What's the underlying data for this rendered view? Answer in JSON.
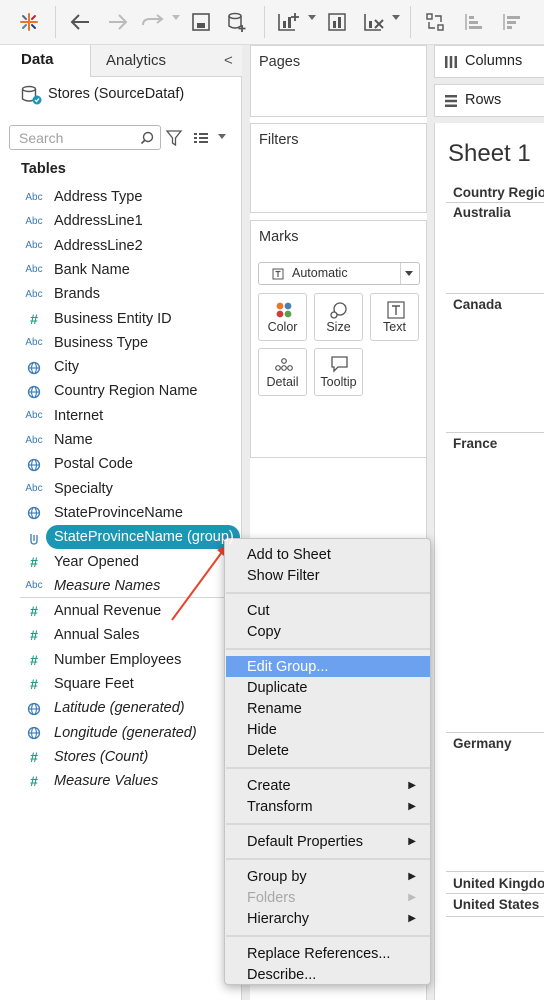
{
  "toolbar": {
    "icons": [
      "tableau-logo-icon",
      "back-icon",
      "forward-icon",
      "redo-icon",
      "save-icon",
      "new-datasource-icon",
      "new-worksheet-icon",
      "duplicate-sheet-icon",
      "clear-sheet-icon",
      "swap-icon",
      "sort-ascending-icon",
      "sort-descending-icon"
    ]
  },
  "data_pane": {
    "tabs": [
      "Data",
      "Analytics"
    ],
    "collapse_glyph": "<",
    "datasource": "Stores (SourceDataf)",
    "search_placeholder": "Search",
    "tables_heading": "Tables",
    "dimensions": [
      {
        "type": "Abc",
        "label": "Address Type"
      },
      {
        "type": "Abc",
        "label": "AddressLine1"
      },
      {
        "type": "Abc",
        "label": "AddressLine2"
      },
      {
        "type": "Abc",
        "label": "Bank Name"
      },
      {
        "type": "Abc",
        "label": "Brands"
      },
      {
        "type": "#",
        "label": "Business Entity ID"
      },
      {
        "type": "Abc",
        "label": "Business Type"
      },
      {
        "type": "globe",
        "label": "City"
      },
      {
        "type": "globe",
        "label": "Country Region Name"
      },
      {
        "type": "Abc",
        "label": "Internet"
      },
      {
        "type": "Abc",
        "label": "Name"
      },
      {
        "type": "globe",
        "label": "Postal Code"
      },
      {
        "type": "Abc",
        "label": "Specialty"
      },
      {
        "type": "globe",
        "label": "StateProvinceName"
      },
      {
        "type": "group",
        "label": "StateProvinceName (group)"
      },
      {
        "type": "#",
        "label": "Year Opened"
      },
      {
        "type": "Abc",
        "label": "Measure Names"
      }
    ],
    "measures": [
      {
        "type": "#",
        "label": "Annual Revenue"
      },
      {
        "type": "#",
        "label": "Annual Sales"
      },
      {
        "type": "#",
        "label": "Number Employees"
      },
      {
        "type": "#",
        "label": "Square Feet"
      },
      {
        "type": "globe",
        "label": "Latitude (generated)"
      },
      {
        "type": "globe",
        "label": "Longitude (generated)"
      },
      {
        "type": "#",
        "label": "Stores (Count)"
      },
      {
        "type": "#",
        "label": "Measure Values"
      }
    ]
  },
  "cards": {
    "pages": "Pages",
    "filters": "Filters",
    "marks": "Marks",
    "mark_type": "Automatic",
    "mark_buttons": [
      "Color",
      "Size",
      "Text",
      "Detail",
      "Tooltip"
    ],
    "columns": "Columns",
    "rows": "Rows"
  },
  "view": {
    "sheet_title": "Sheet 1",
    "header": "Country Regio",
    "rows": [
      "Australia",
      "Canada",
      "France",
      "Germany",
      "United Kingdo",
      "United States"
    ]
  },
  "context_menu": {
    "groups": [
      [
        {
          "label": "Add to Sheet"
        },
        {
          "label": "Show Filter"
        }
      ],
      [
        {
          "label": "Cut"
        },
        {
          "label": "Copy"
        }
      ],
      [
        {
          "label": "Edit Group...",
          "highlighted": true
        },
        {
          "label": "Duplicate"
        },
        {
          "label": "Rename"
        },
        {
          "label": "Hide"
        },
        {
          "label": "Delete"
        }
      ],
      [
        {
          "label": "Create",
          "submenu": true
        },
        {
          "label": "Transform",
          "submenu": true
        }
      ],
      [
        {
          "label": "Default Properties",
          "submenu": true
        }
      ],
      [
        {
          "label": "Group by",
          "submenu": true
        },
        {
          "label": "Folders",
          "submenu": true,
          "disabled": true
        },
        {
          "label": "Hierarchy",
          "submenu": true
        }
      ],
      [
        {
          "label": "Replace References..."
        },
        {
          "label": "Describe..."
        }
      ]
    ]
  },
  "colors": {
    "selected_pill": "#1b96b3",
    "menu_highlight": "#6ba1ef",
    "annotation_arrow": "#e8442c",
    "dimension_icon": "#3a7ab5",
    "measure_icon": "#1c9e86"
  }
}
